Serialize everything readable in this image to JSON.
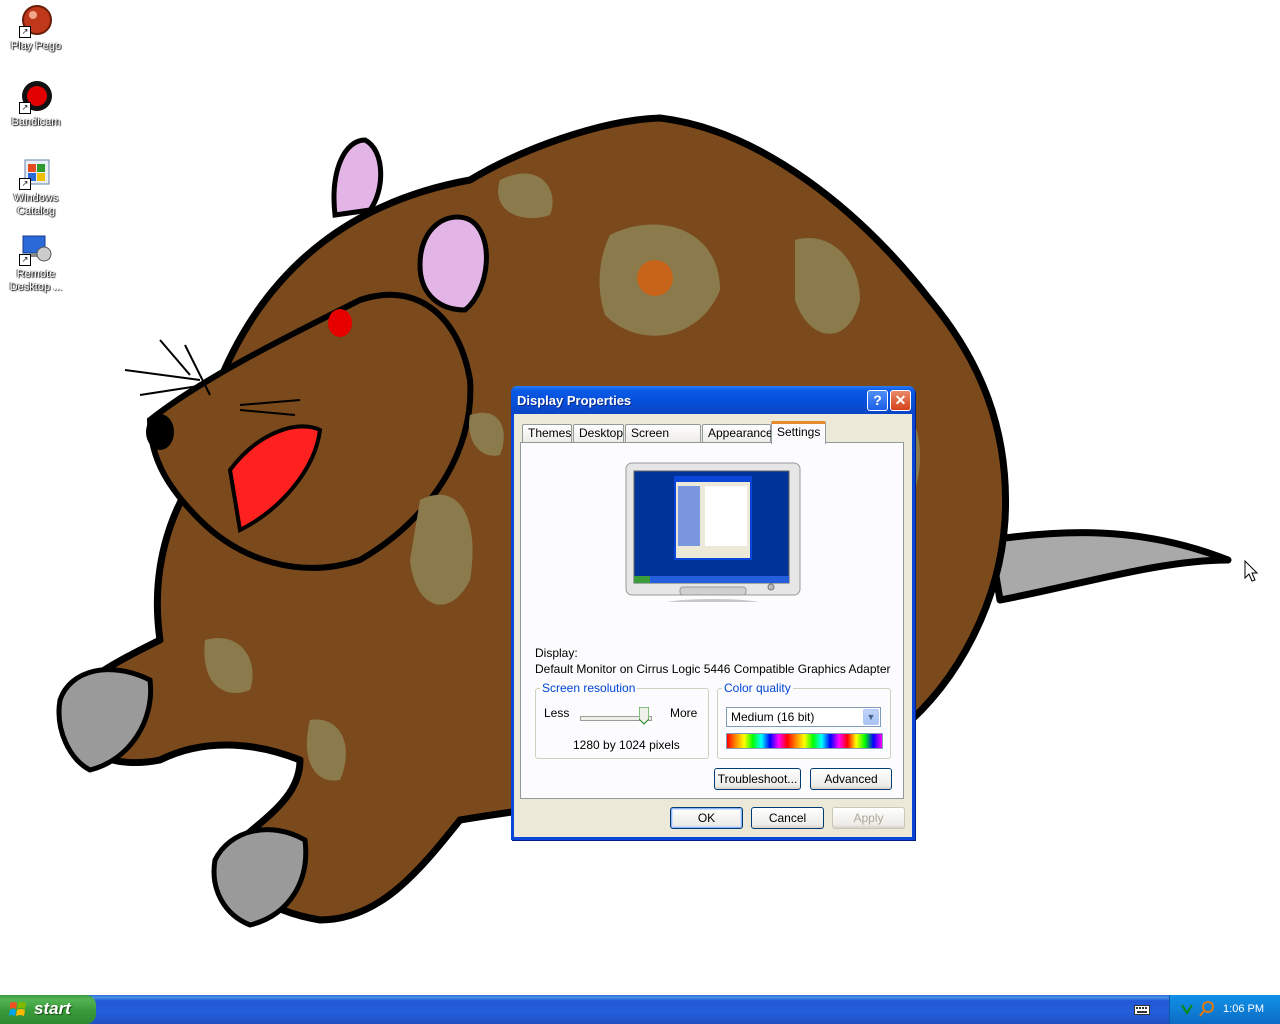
{
  "desktop": {
    "icons": [
      {
        "label": "Play Pego",
        "icon": "play-pego-icon"
      },
      {
        "label": "Bandicam",
        "icon": "bandicam-icon"
      },
      {
        "label": "Windows Catalog",
        "icon": "windows-catalog-icon"
      },
      {
        "label": "Remote Desktop ...",
        "icon": "remote-desktop-icon"
      }
    ]
  },
  "dialog": {
    "title": "Display Properties",
    "tabs": [
      "Themes",
      "Desktop",
      "Screen Saver",
      "Appearance",
      "Settings"
    ],
    "active_tab": "Settings",
    "display_label": "Display:",
    "display_value": "Default Monitor on Cirrus Logic 5446 Compatible Graphics Adapter",
    "resolution": {
      "legend": "Screen resolution",
      "less": "Less",
      "more": "More",
      "value": "1280 by 1024 pixels"
    },
    "color": {
      "legend": "Color quality",
      "selected": "Medium (16 bit)"
    },
    "buttons": {
      "troubleshoot": "Troubleshoot...",
      "advanced": "Advanced",
      "ok": "OK",
      "cancel": "Cancel",
      "apply": "Apply"
    }
  },
  "taskbar": {
    "start_label": "start",
    "clock": "1:06 PM"
  },
  "colors": {
    "title_blue": "#0a46d8",
    "taskbar_blue": "#245edb",
    "start_green": "#3a9d3a",
    "dialog_face": "#ece9d8"
  }
}
